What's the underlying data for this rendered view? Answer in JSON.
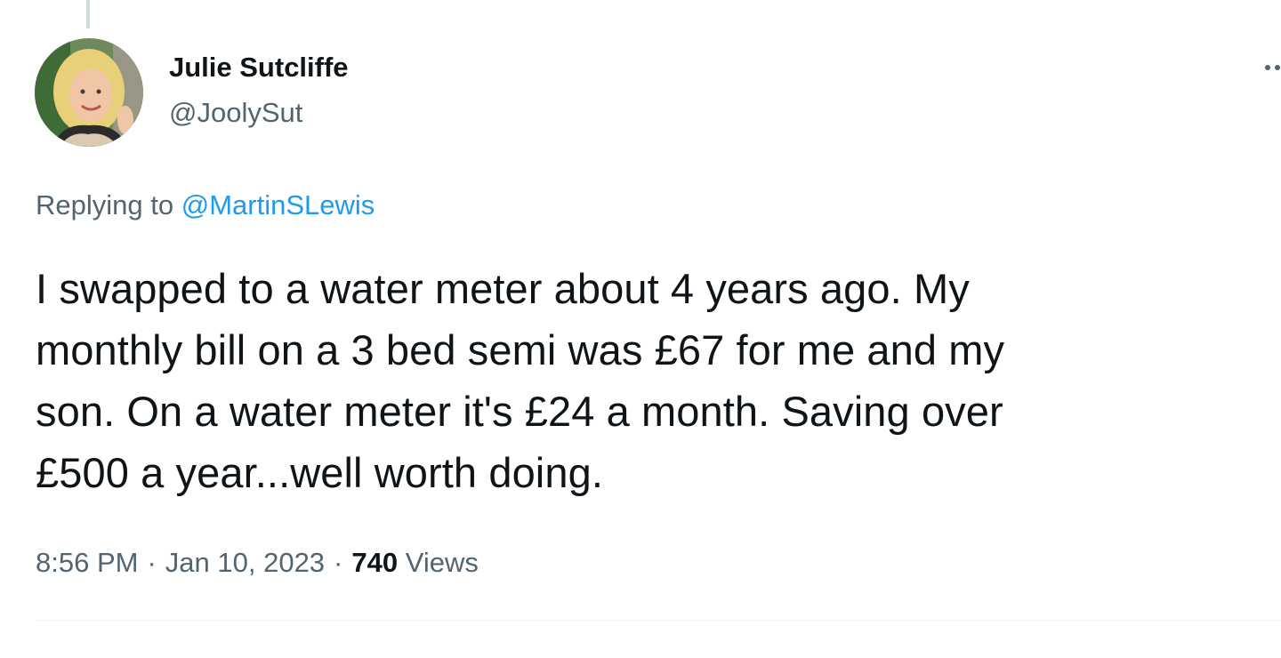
{
  "tweet": {
    "author": {
      "display_name": "Julie Sutcliffe",
      "handle": "@JoolySut",
      "avatar_icon": "profile-photo"
    },
    "replying_to": {
      "prefix": "Replying to",
      "mention": "@MartinSLewis"
    },
    "body_lines": [
      "I swapped to a water meter about 4 years ago. My",
      "monthly bill on a 3 bed semi was £67 for me and my",
      "son. On a water meter it's £24 a month. Saving over",
      "£500 a year...well worth doing."
    ],
    "time": "8:56 PM",
    "separator": "·",
    "date": "Jan 10, 2023",
    "views_count": "740",
    "views_label": "Views",
    "more_icon": "more-options-icon"
  },
  "colors": {
    "text_primary": "#0f1419",
    "text_secondary": "#536471",
    "accent": "#1d9bf0",
    "divider": "#eff3f4"
  }
}
